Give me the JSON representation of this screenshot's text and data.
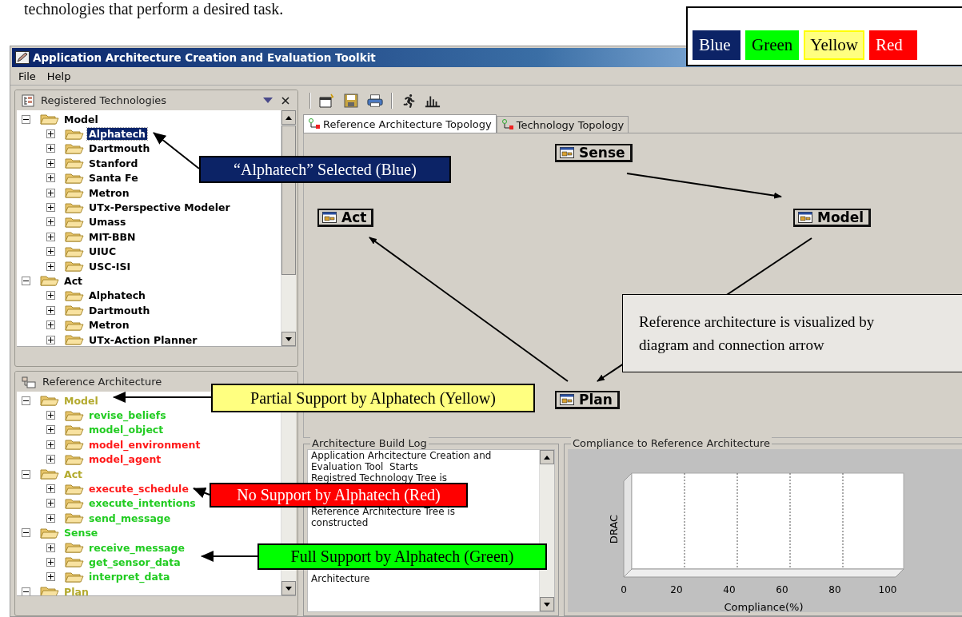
{
  "intro_text": "technologies that perform a desired task.",
  "legend": [
    {
      "label": "Blue",
      "color": "#0c2366"
    },
    {
      "label": "Green",
      "color": "#00ff00"
    },
    {
      "label": "Yellow",
      "color": "#ffff80"
    },
    {
      "label": "Red",
      "color": "#ff0000"
    }
  ],
  "window": {
    "title": "Application Architecture Creation and Evaluation Toolkit"
  },
  "menu": [
    "File",
    "Help"
  ],
  "registered_technologies": {
    "title": "Registered Technologies",
    "tree": [
      {
        "label": "Model",
        "expanded": true,
        "selected": false,
        "children": [
          {
            "label": "Alphatech",
            "expanded": false,
            "selected": true
          },
          {
            "label": "Dartmouth",
            "expanded": false,
            "selected": false
          },
          {
            "label": "Stanford",
            "expanded": false,
            "selected": false
          },
          {
            "label": "Santa Fe",
            "expanded": false,
            "selected": false
          },
          {
            "label": "Metron",
            "expanded": false,
            "selected": false
          },
          {
            "label": "UTx-Perspective Modeler",
            "expanded": false,
            "selected": false
          },
          {
            "label": "Umass",
            "expanded": false,
            "selected": false
          },
          {
            "label": "MIT-BBN",
            "expanded": false,
            "selected": false
          },
          {
            "label": "UIUC",
            "expanded": false,
            "selected": false
          },
          {
            "label": "USC-ISI",
            "expanded": false,
            "selected": false
          }
        ]
      },
      {
        "label": "Act",
        "expanded": true,
        "selected": false,
        "children": [
          {
            "label": "Alphatech",
            "expanded": false,
            "selected": false
          },
          {
            "label": "Dartmouth",
            "expanded": false,
            "selected": false
          },
          {
            "label": "Metron",
            "expanded": false,
            "selected": false
          },
          {
            "label": "UTx-Action Planner",
            "expanded": false,
            "selected": false
          }
        ]
      }
    ]
  },
  "reference_architecture": {
    "title": "Reference Architecture",
    "tree": [
      {
        "label": "Model",
        "expanded": true,
        "color": "#b3aa2e",
        "children": [
          {
            "label": "revise_beliefs",
            "expanded": false,
            "color": "#22cc22"
          },
          {
            "label": "model_object",
            "expanded": false,
            "color": "#22cc22"
          },
          {
            "label": "model_environment",
            "expanded": false,
            "color": "#ff1a1a"
          },
          {
            "label": "model_agent",
            "expanded": false,
            "color": "#ff1a1a"
          }
        ]
      },
      {
        "label": "Act",
        "expanded": true,
        "color": "#b3aa2e",
        "children": [
          {
            "label": "execute_schedule",
            "expanded": false,
            "color": "#ff1a1a"
          },
          {
            "label": "execute_intentions",
            "expanded": false,
            "color": "#22cc22"
          },
          {
            "label": "send_message",
            "expanded": false,
            "color": "#22cc22"
          }
        ]
      },
      {
        "label": "Sense",
        "expanded": true,
        "color": "#22cc22",
        "children": [
          {
            "label": "receive_message",
            "expanded": false,
            "color": "#22cc22"
          },
          {
            "label": "get_sensor_data",
            "expanded": false,
            "color": "#22cc22"
          },
          {
            "label": "interpret_data",
            "expanded": false,
            "color": "#22cc22"
          }
        ]
      },
      {
        "label": "Plan",
        "expanded": true,
        "color": "#b3aa2e"
      }
    ]
  },
  "tabs": [
    {
      "label": "Reference Architecture Topology",
      "selected": true
    },
    {
      "label": "Technology Topology",
      "selected": false
    }
  ],
  "diagram": {
    "nodes": [
      "Sense",
      "Model",
      "Act",
      "Plan"
    ]
  },
  "build_log": {
    "title": "Architecture Build Log",
    "entries": [
      "Application Arhcitecture Creation and Evaluation Tool  Starts",
      "Registred Technology Tree is",
      "Reference Architecture Tree is constructed",
      "Architecture"
    ]
  },
  "compliance": {
    "title": "Compliance to Reference Architecture",
    "x_ticks": [
      "0",
      "20",
      "40",
      "60",
      "80",
      "100"
    ],
    "x_title": "Compliance(%)",
    "y_title": "DRAC"
  },
  "callouts": [
    {
      "text": "“Alphatech” Selected (Blue)",
      "color": "#0c2366"
    },
    {
      "text": "Partial Support by Alphatech (Yellow)",
      "color": "#ffff80"
    },
    {
      "text": "No Support by Alphatech (Red)",
      "color": "#ff0000"
    },
    {
      "text": "Full Support by Alphatech (Green)",
      "color": "#00ff00"
    }
  ],
  "note": "Reference architecture is visualized by diagram and connection arrow"
}
